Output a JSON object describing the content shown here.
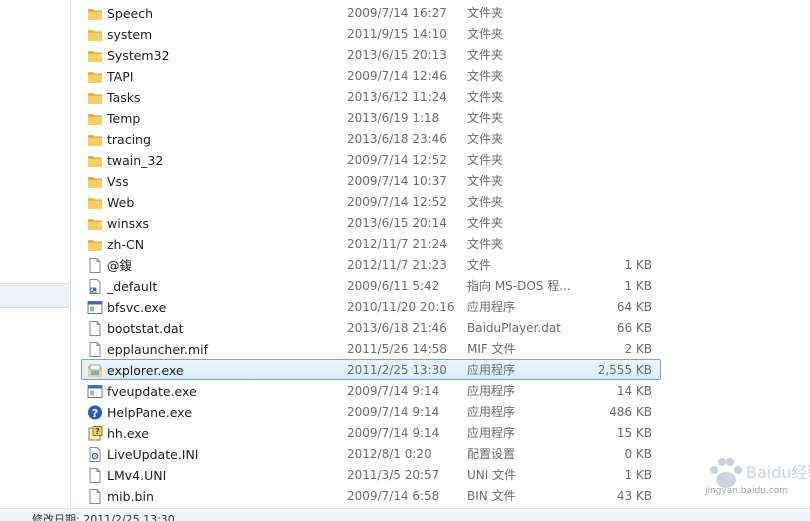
{
  "files": [
    {
      "name": "Speech",
      "date": "2009/7/14 16:27",
      "type": "文件夹",
      "size": "",
      "icon": "folder-icon"
    },
    {
      "name": "system",
      "date": "2011/9/15 14:10",
      "type": "文件夹",
      "size": "",
      "icon": "folder-icon"
    },
    {
      "name": "System32",
      "date": "2013/6/15 20:13",
      "type": "文件夹",
      "size": "",
      "icon": "folder-icon"
    },
    {
      "name": "TAPI",
      "date": "2009/7/14 12:46",
      "type": "文件夹",
      "size": "",
      "icon": "folder-icon"
    },
    {
      "name": "Tasks",
      "date": "2013/6/12 11:24",
      "type": "文件夹",
      "size": "",
      "icon": "folder-icon"
    },
    {
      "name": "Temp",
      "date": "2013/6/19 1:18",
      "type": "文件夹",
      "size": "",
      "icon": "folder-icon"
    },
    {
      "name": "tracing",
      "date": "2013/6/18 23:46",
      "type": "文件夹",
      "size": "",
      "icon": "folder-icon"
    },
    {
      "name": "twain_32",
      "date": "2009/7/14 12:52",
      "type": "文件夹",
      "size": "",
      "icon": "folder-icon"
    },
    {
      "name": "Vss",
      "date": "2009/7/14 10:37",
      "type": "文件夹",
      "size": "",
      "icon": "folder-icon"
    },
    {
      "name": "Web",
      "date": "2009/7/14 12:52",
      "type": "文件夹",
      "size": "",
      "icon": "folder-icon"
    },
    {
      "name": "winsxs",
      "date": "2013/6/15 20:14",
      "type": "文件夹",
      "size": "",
      "icon": "folder-icon"
    },
    {
      "name": "zh-CN",
      "date": "2012/11/7 21:24",
      "type": "文件夹",
      "size": "",
      "icon": "folder-icon"
    },
    {
      "name": "@鍑",
      "date": "2012/11/7 21:23",
      "type": "文件",
      "size": "1 KB",
      "icon": "file-icon"
    },
    {
      "name": "_default",
      "date": "2009/6/11 5:42",
      "type": "指向 MS-DOS 程...",
      "size": "1 KB",
      "icon": "shortcut-icon"
    },
    {
      "name": "bfsvc.exe",
      "date": "2010/11/20 20:16",
      "type": "应用程序",
      "size": "64 KB",
      "icon": "exe-icon"
    },
    {
      "name": "bootstat.dat",
      "date": "2013/6/18 21:46",
      "type": "BaiduPlayer.dat",
      "size": "66 KB",
      "icon": "file-icon"
    },
    {
      "name": "epplauncher.mif",
      "date": "2011/5/26 14:58",
      "type": "MIF 文件",
      "size": "2 KB",
      "icon": "file-icon"
    },
    {
      "name": "explorer.exe",
      "date": "2011/2/25 13:30",
      "type": "应用程序",
      "size": "2,555 KB",
      "icon": "explorer-icon",
      "selected": true
    },
    {
      "name": "fveupdate.exe",
      "date": "2009/7/14 9:14",
      "type": "应用程序",
      "size": "14 KB",
      "icon": "exe-icon"
    },
    {
      "name": "HelpPane.exe",
      "date": "2009/7/14 9:14",
      "type": "应用程序",
      "size": "486 KB",
      "icon": "help-icon"
    },
    {
      "name": "hh.exe",
      "date": "2009/7/14 9:14",
      "type": "应用程序",
      "size": "15 KB",
      "icon": "chm-icon"
    },
    {
      "name": "LiveUpdate.INI",
      "date": "2012/8/1 0:20",
      "type": "配置设置",
      "size": "0 KB",
      "icon": "ini-icon"
    },
    {
      "name": "LMv4.UNI",
      "date": "2011/3/5 20:57",
      "type": "UNI 文件",
      "size": "1 KB",
      "icon": "file-icon"
    },
    {
      "name": "mib.bin",
      "date": "2009/7/14 6:58",
      "type": "BIN 文件",
      "size": "43 KB",
      "icon": "file-icon"
    }
  ],
  "status": {
    "text": "修改日期: 2011/2/25 13:30"
  },
  "watermark": {
    "brand": "Baidu经验",
    "url": "jingyan.baidu.com"
  }
}
